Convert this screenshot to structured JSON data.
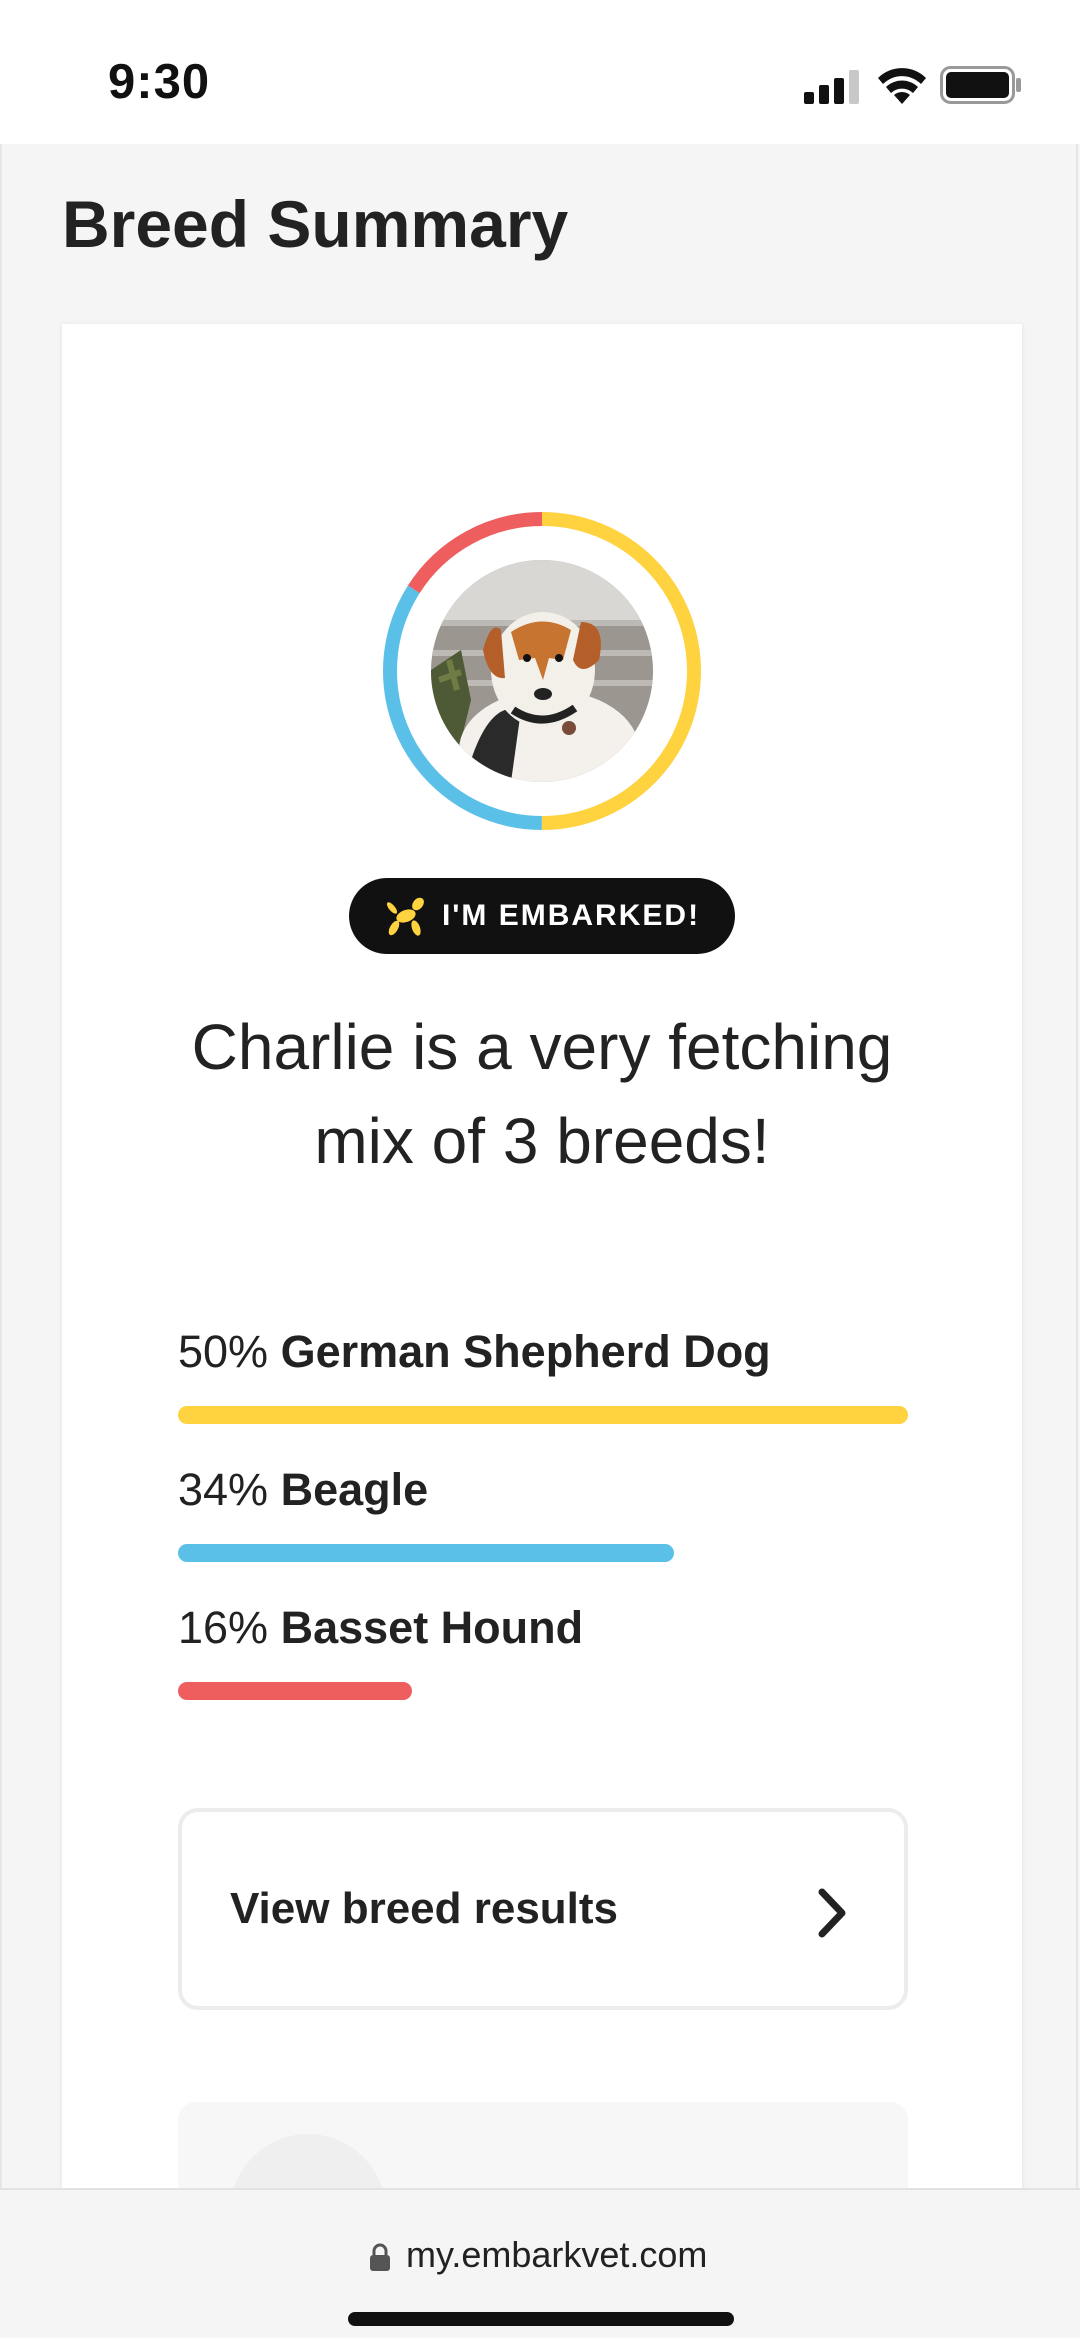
{
  "status_bar": {
    "time": "9:30"
  },
  "page": {
    "title": "Breed Summary"
  },
  "badge": {
    "label": "I'M EMBARKED!"
  },
  "summary": {
    "text": "Charlie is a very fetching mix of 3 breeds!"
  },
  "breeds": [
    {
      "percent_label": "50%",
      "percent": 50,
      "name": "German Shepherd Dog",
      "color": "#FFD23F"
    },
    {
      "percent_label": "34%",
      "percent": 34,
      "name": "Beagle",
      "color": "#5BC0E8"
    },
    {
      "percent_label": "16%",
      "percent": 16,
      "name": "Basset Hound",
      "color": "#EE5E5E"
    }
  ],
  "results_button": {
    "label": "View breed results"
  },
  "browser": {
    "url": "my.embarkvet.com"
  },
  "colors": {
    "accent_yellow": "#FFD23F",
    "accent_blue": "#5BC0E8",
    "accent_red": "#EE5E5E"
  }
}
